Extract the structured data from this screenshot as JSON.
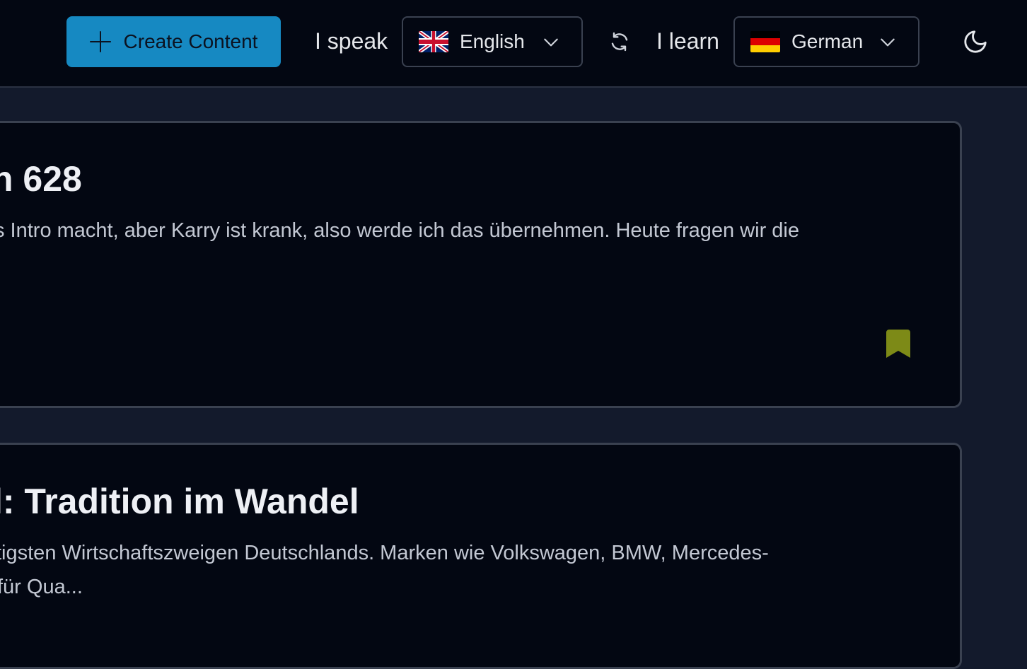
{
  "header": {
    "create_label": "Create Content",
    "speak_label": "I speak",
    "learn_label": "I learn",
    "native_language": "English",
    "target_language": "German",
    "icons": {
      "create": "plus-icon",
      "native_flag": "uk-flag-icon",
      "target_flag": "germany-flag-icon",
      "dropdown": "chevron-down-icon",
      "swap": "swap-languages-icon",
      "theme": "moon-icon"
    },
    "colors": {
      "create_button": "#1689c2",
      "header_bg": "#030712"
    }
  },
  "cards": [
    {
      "title": "n 628",
      "description_line1": "s Intro macht, aber Karry ist krank, also werde ich das übernehmen. Heute fragen wir die",
      "bookmark_color": "#7d8a17"
    },
    {
      "title": "l: Tradition im Wandel",
      "description_line1": "tigsten Wirtschaftszweigen Deutschlands. Marken wie Volkswagen, BMW, Mercedes-",
      "description_line2": "für Qua..."
    }
  ]
}
